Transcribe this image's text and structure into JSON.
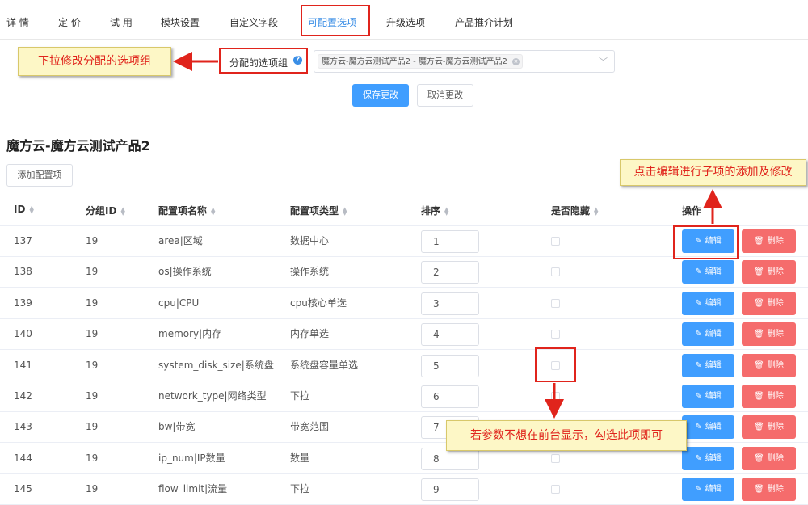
{
  "tabs": [
    {
      "label": "详 情"
    },
    {
      "label": "定 价"
    },
    {
      "label": "试 用"
    },
    {
      "label": "模块设置"
    },
    {
      "label": "自定义字段"
    },
    {
      "label": "可配置选项",
      "active": true
    },
    {
      "label": "升级选项"
    },
    {
      "label": "产品推介计划"
    }
  ],
  "option_group": {
    "label": "分配的选项组",
    "help_icon": "question-circle-icon",
    "selected_tag": "魔方云-魔方云测试产品2 - 魔方云-魔方云测试产品2"
  },
  "annotations": {
    "left": "下拉修改分配的选项组",
    "right": "点击编辑进行子项的添加及修改",
    "bottom": "若参数不想在前台显示，勾选此项即可"
  },
  "actions": {
    "save": "保存更改",
    "cancel": "取消更改"
  },
  "product_title": "魔方云-魔方云测试产品2",
  "add_button": "添加配置项",
  "table": {
    "headers": {
      "id": "ID",
      "group_id": "分组ID",
      "name": "配置项名称",
      "type": "配置项类型",
      "order": "排序",
      "hidden": "是否隐藏",
      "ops": "操作"
    },
    "edit_label": "编辑",
    "delete_label": "删除",
    "rows": [
      {
        "id": "137",
        "group_id": "19",
        "name": "area|区域",
        "type": "数据中心",
        "order": "1",
        "hidden": false
      },
      {
        "id": "138",
        "group_id": "19",
        "name": "os|操作系统",
        "type": "操作系统",
        "order": "2",
        "hidden": false
      },
      {
        "id": "139",
        "group_id": "19",
        "name": "cpu|CPU",
        "type": "cpu核心单选",
        "order": "3",
        "hidden": false
      },
      {
        "id": "140",
        "group_id": "19",
        "name": "memory|内存",
        "type": "内存单选",
        "order": "4",
        "hidden": false
      },
      {
        "id": "141",
        "group_id": "19",
        "name": "system_disk_size|系统盘",
        "type": "系统盘容量单选",
        "order": "5",
        "hidden": false
      },
      {
        "id": "142",
        "group_id": "19",
        "name": "network_type|网络类型",
        "type": "下拉",
        "order": "6",
        "hidden": false
      },
      {
        "id": "143",
        "group_id": "19",
        "name": "bw|带宽",
        "type": "带宽范围",
        "order": "7",
        "hidden": false
      },
      {
        "id": "144",
        "group_id": "19",
        "name": "ip_num|IP数量",
        "type": "数量",
        "order": "8",
        "hidden": false
      },
      {
        "id": "145",
        "group_id": "19",
        "name": "flow_limit|流量",
        "type": "下拉",
        "order": "9",
        "hidden": false
      }
    ]
  },
  "colors": {
    "primary": "#409eff",
    "danger": "#f56c6c",
    "highlight": "#e0241c",
    "callout_bg": "#fdf7c6"
  }
}
